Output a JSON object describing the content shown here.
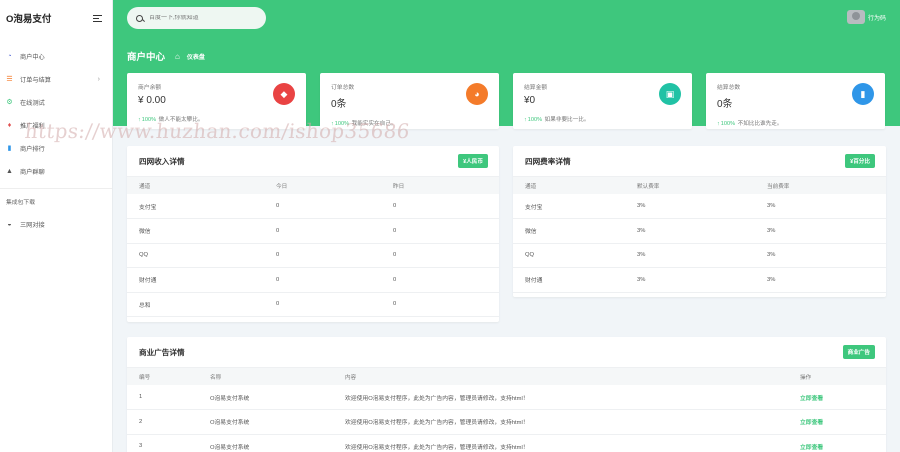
{
  "brand": "O泡易支付",
  "sidebar": {
    "items": [
      {
        "label": "商户中心",
        "icon": "dashboard-icon",
        "color": "#5b6fd8"
      },
      {
        "label": "订单与结算",
        "icon": "list-icon",
        "color": "#f47b2a",
        "has_children": true
      },
      {
        "label": "在线测试",
        "icon": "gear-icon",
        "color": "#3ec77d"
      },
      {
        "label": "推广福利",
        "icon": "gift-icon",
        "color": "#e05050"
      },
      {
        "label": "商户排行",
        "icon": "bar-chart-icon",
        "color": "#2f96e8"
      },
      {
        "label": "商户群聊",
        "icon": "graduation-cap-icon",
        "color": "#555555"
      }
    ],
    "section_label": "集成包下载",
    "section_items": [
      {
        "label": "三网对接",
        "icon": "wifi-icon",
        "color": "#555555"
      }
    ]
  },
  "header": {
    "search_placeholder": "百度一下,你就知道",
    "user_name": "行为码",
    "page_title": "商户中心",
    "breadcrumb": "仪表盘"
  },
  "stats": [
    {
      "label": "商户余额",
      "value": "¥ 0.00",
      "percent": "100%",
      "note": "做人不能太攀比。",
      "icon": "diamond-icon",
      "color": "#e94343"
    },
    {
      "label": "订单总数",
      "value": "0条",
      "percent": "100%",
      "note": "我能实实在自己。",
      "icon": "pie-chart-icon",
      "color": "#f47b2a"
    },
    {
      "label": "结算金额",
      "value": "¥0",
      "percent": "100%",
      "note": "如果非要比一比。",
      "icon": "wallet-icon",
      "color": "#21c2a5"
    },
    {
      "label": "结算总数",
      "value": "0条",
      "percent": "100%",
      "note": "不如比比谁先走。",
      "icon": "bar-chart-icon",
      "color": "#2f96e8"
    }
  ],
  "income": {
    "title": "四网收入详情",
    "button": "¥人民币",
    "columns": [
      "通道",
      "今日",
      "昨日"
    ],
    "rows": [
      [
        "支付宝",
        "0",
        "0"
      ],
      [
        "微信",
        "0",
        "0"
      ],
      [
        "QQ",
        "0",
        "0"
      ],
      [
        "财付通",
        "0",
        "0"
      ],
      [
        "总和",
        "0",
        "0"
      ]
    ]
  },
  "rates": {
    "title": "四网费率详情",
    "button": "¥百分比",
    "columns": [
      "通道",
      "默认费率",
      "当前费率"
    ],
    "rows": [
      [
        "支付宝",
        "3%",
        "3%"
      ],
      [
        "微信",
        "3%",
        "3%"
      ],
      [
        "QQ",
        "3%",
        "3%"
      ],
      [
        "财付通",
        "3%",
        "3%"
      ]
    ]
  },
  "ads": {
    "title": "商业广告详情",
    "button": "商业广告",
    "columns": [
      "编号",
      "名称",
      "内容",
      "操作"
    ],
    "rows": [
      [
        "1",
        "O泡易支付系统",
        "欢迎使用O泡易支付程序，此处为广告内容，管理员请修改，支持html！",
        "立即查看"
      ],
      [
        "2",
        "O泡易支付系统",
        "欢迎使用O泡易支付程序，此处为广告内容，管理员请修改，支持html！",
        "立即查看"
      ],
      [
        "3",
        "O泡易支付系统",
        "欢迎使用O泡易支付程序，此处为广告内容，管理员请修改，支持html！",
        "立即查看"
      ]
    ]
  },
  "watermark": "https://www.huzhan.com/ishop35686",
  "accent": "#3ec77d"
}
